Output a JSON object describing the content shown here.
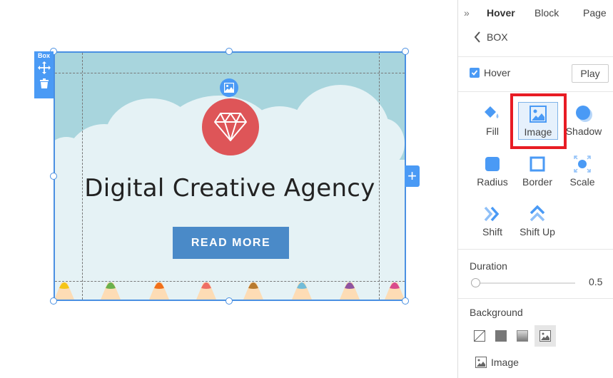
{
  "canvas": {
    "box_label": "Box",
    "headline": "Digital Creative Agency",
    "button_label": "READ MORE",
    "add_label": "+",
    "colors": {
      "sky": "#a8d5dd",
      "cloud": "#e5f2f5",
      "badge": "#de5558",
      "button": "#4a8ac8",
      "selection": "#4a90e2"
    },
    "pencil_colors": [
      "#f5c518",
      "#6ab04c",
      "#f0701a",
      "#ee6f64",
      "#b87a2e",
      "#72bcd8",
      "#8e54a0",
      "#d94c8c"
    ]
  },
  "panel": {
    "collapse_icon": "»",
    "tabs": [
      {
        "label": "Hover",
        "active": true
      },
      {
        "label": "Block",
        "active": false
      },
      {
        "label": "Page",
        "active": false
      }
    ],
    "back_label": "BOX",
    "hover_checkbox": {
      "label": "Hover",
      "checked": true
    },
    "play_label": "Play",
    "options": [
      {
        "label": "Fill",
        "icon": "fill-icon"
      },
      {
        "label": "Image",
        "icon": "image-icon",
        "selected": true
      },
      {
        "label": "Shadow",
        "icon": "shadow-icon"
      },
      {
        "label": "Radius",
        "icon": "radius-icon"
      },
      {
        "label": "Border",
        "icon": "border-icon"
      },
      {
        "label": "Scale",
        "icon": "scale-icon"
      },
      {
        "label": "Shift",
        "icon": "shift-icon"
      },
      {
        "label": "Shift Up",
        "icon": "shift-up-icon"
      }
    ],
    "duration": {
      "label": "Duration",
      "value": "0.5",
      "slider_fraction": 0.0
    },
    "background": {
      "label": "Background",
      "types": [
        "none",
        "solid",
        "gradient",
        "image"
      ],
      "selected": "image",
      "image_label": "Image"
    }
  }
}
